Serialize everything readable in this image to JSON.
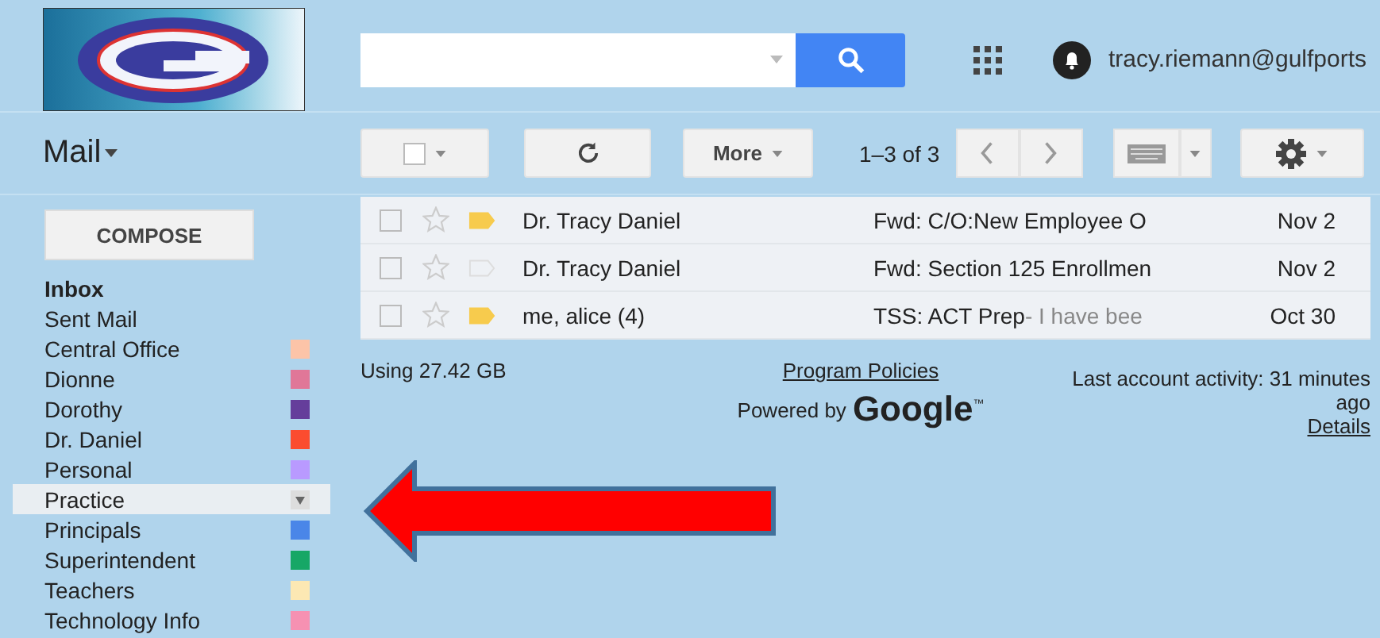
{
  "header": {
    "account": "tracy.riemann@gulfports"
  },
  "app_menu": {
    "label": "Mail"
  },
  "toolbar": {
    "more": "More",
    "page_range": "1–3 of 3"
  },
  "compose": "COMPOSE",
  "folders": [
    {
      "label": "Inbox",
      "kind": "system",
      "bold": true,
      "selected": false
    },
    {
      "label": "Sent Mail",
      "kind": "system",
      "bold": false,
      "selected": false
    },
    {
      "label": "Central Office",
      "kind": "label",
      "color": "#fcc4a8",
      "bold": false,
      "selected": false
    },
    {
      "label": "Dionne",
      "kind": "label",
      "color": "#e07798",
      "bold": false,
      "selected": false
    },
    {
      "label": "Dorothy",
      "kind": "label",
      "color": "#653e9b",
      "bold": false,
      "selected": false
    },
    {
      "label": "Dr. Daniel",
      "kind": "label",
      "color": "#fb4c2f",
      "bold": false,
      "selected": false
    },
    {
      "label": "Personal",
      "kind": "label",
      "color": "#b99aff",
      "bold": false,
      "selected": false
    },
    {
      "label": "Practice",
      "kind": "label",
      "bold": false,
      "selected": true
    },
    {
      "label": "Principals",
      "kind": "label",
      "color": "#4a86e8",
      "bold": false,
      "selected": false
    },
    {
      "label": "Superintendent",
      "kind": "label",
      "color": "#16a766",
      "bold": false,
      "selected": false
    },
    {
      "label": "Teachers",
      "kind": "label",
      "color": "#fce8b3",
      "bold": false,
      "selected": false
    },
    {
      "label": "Technology Info",
      "kind": "label",
      "color": "#f691b2",
      "bold": false,
      "selected": false
    }
  ],
  "messages": [
    {
      "sender": "Dr. Tracy Daniel",
      "subject": "Fwd: C/O:New Employee O",
      "date": "Nov 2",
      "checked": false,
      "starred": false,
      "important": true
    },
    {
      "sender": "Dr. Tracy Daniel",
      "subject": "Fwd: Section 125 Enrollmen",
      "date": "Nov 2",
      "checked": false,
      "starred": false,
      "important": false
    },
    {
      "sender": "me, alice (4)",
      "subject": "TSS: ACT Prep",
      "snippet": "- I have bee",
      "date": "Oct 30",
      "checked": false,
      "starred": false,
      "important": true
    }
  ],
  "footer": {
    "storage": "Using 27.42 GB",
    "policies": "Program Policies",
    "powered_by": "Powered by",
    "brand": "Google",
    "trademark": "™",
    "activity": "Last account activity: 31 minutes ago",
    "details": "Details"
  }
}
